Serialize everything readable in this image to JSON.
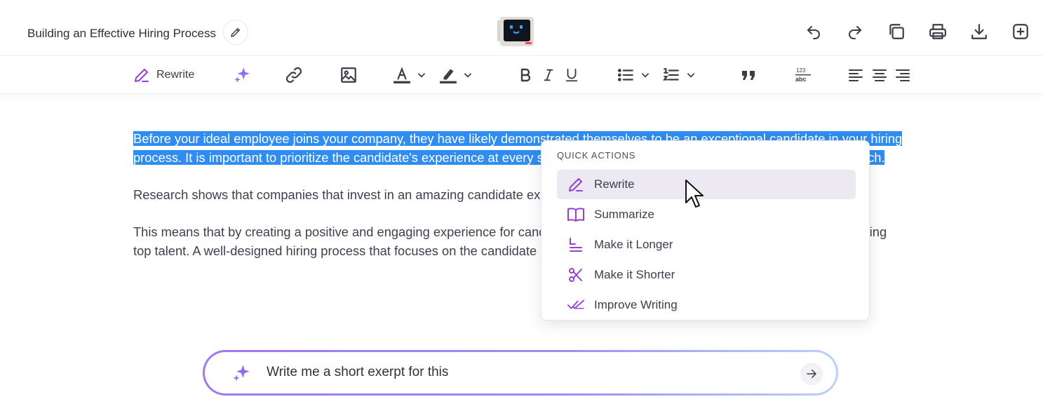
{
  "header": {
    "doc_title": "Building an Effective Hiring Process"
  },
  "toolbar": {
    "rewrite_label": "Rewrite"
  },
  "content": {
    "paragraphs": [
      {
        "selected": "Before your ideal employee joins your company, they have likely demonstrated themselves to be an exceptional candidate in your hiring process. It is important to prioritize the candidate's experience at every step of the process to ensure the chances of a perfect match."
      },
      {
        "text": "Research shows that companies that invest in an amazing candidate experience improve the quality of their new hires by 70%."
      },
      {
        "text": "This means that by creating a positive and engaging experience for candidates, you can significantly improve attracting and selecting top talent. A well-designed hiring process that focuses on the candidate experience can lead to better hires for your company."
      }
    ]
  },
  "quick_actions": {
    "heading": "QUICK ACTIONS",
    "items": [
      {
        "label": "Rewrite",
        "icon": "pencil-icon"
      },
      {
        "label": "Summarize",
        "icon": "book-icon"
      },
      {
        "label": "Make it Longer",
        "icon": "lines-icon"
      },
      {
        "label": "Make it Shorter",
        "icon": "scissors-icon"
      },
      {
        "label": "Improve Writing",
        "icon": "double-check-icon"
      }
    ]
  },
  "prompt": {
    "value": "Write me a short exerpt for this"
  },
  "colors": {
    "accent": "#9a3fcf",
    "selection": "#2f8cf0",
    "icon": "#3a3d46"
  }
}
